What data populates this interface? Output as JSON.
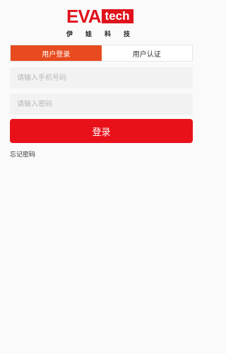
{
  "logo": {
    "brand_red": "EVA",
    "brand_box": "tech",
    "chars": [
      "伊",
      "娃",
      "科",
      "技"
    ]
  },
  "tabs": [
    {
      "label": "用户登录",
      "active": true
    },
    {
      "label": "用户认证",
      "active": false
    }
  ],
  "form": {
    "phone_placeholder": "请输入手机号码",
    "password_placeholder": "请输入密码",
    "login_label": "登录",
    "forgot_label": "忘记密码"
  },
  "colors": {
    "accent": "#e8111a",
    "tab_active": "#e84b1f",
    "field_bg": "#f2f2f2",
    "page_bg": "#fafafa"
  }
}
